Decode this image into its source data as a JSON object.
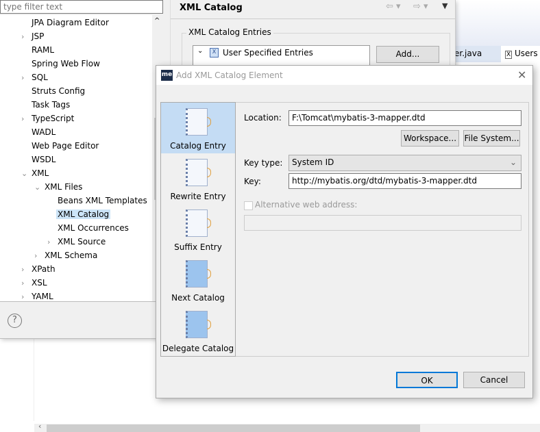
{
  "prefs": {
    "filter_placeholder": "type filter text",
    "tree": [
      {
        "label": "JPA Diagram Editor",
        "expand": ""
      },
      {
        "label": "JSP",
        "expand": ">"
      },
      {
        "label": "RAML",
        "expand": ""
      },
      {
        "label": "Spring Web Flow",
        "expand": ""
      },
      {
        "label": "SQL",
        "expand": ">"
      },
      {
        "label": "Struts Config",
        "expand": ""
      },
      {
        "label": "Task Tags",
        "expand": ""
      },
      {
        "label": "TypeScript",
        "expand": ">"
      },
      {
        "label": "WADL",
        "expand": ""
      },
      {
        "label": "Web Page Editor",
        "expand": ""
      },
      {
        "label": "WSDL",
        "expand": ""
      },
      {
        "label": "XML",
        "expand": "v"
      },
      {
        "label": "XML Files",
        "expand": "v"
      },
      {
        "label": "Beans XML Templates",
        "expand": ""
      },
      {
        "label": "XML Catalog",
        "expand": "",
        "selected": true
      },
      {
        "label": "XML Occurrences",
        "expand": ""
      },
      {
        "label": "XML Source",
        "expand": ">"
      },
      {
        "label": "XML Schema",
        "expand": ">"
      },
      {
        "label": "XPath",
        "expand": ">"
      },
      {
        "label": "XSL",
        "expand": ">"
      },
      {
        "label": "YAML",
        "expand": ">"
      }
    ],
    "page_title": "XML Catalog",
    "group_label": "XML Catalog Entries",
    "entries_root": "User Specified Entries",
    "add_button": "Add...",
    "help_icon": "?"
  },
  "editor": {
    "tabs": [
      "er.java",
      "Users"
    ]
  },
  "dialog": {
    "title": "Add XML Catalog Element",
    "logo": "me",
    "side_items": [
      "Catalog Entry",
      "Rewrite Entry",
      "Suffix Entry",
      "Next Catalog",
      "Delegate Catalog"
    ],
    "location_label": "Location:",
    "location_value": "F:\\Tomcat\\mybatis-3-mapper.dtd",
    "workspace_button": "Workspace...",
    "filesystem_button": "File System...",
    "keytype_label": "Key type:",
    "keytype_value": "System ID",
    "key_label": "Key:",
    "key_value": "http://mybatis.org/dtd/mybatis-3-mapper.dtd",
    "altweb_label": "Alternative web address:",
    "altweb_value": "",
    "ok_button": "OK",
    "cancel_button": "Cancel"
  }
}
